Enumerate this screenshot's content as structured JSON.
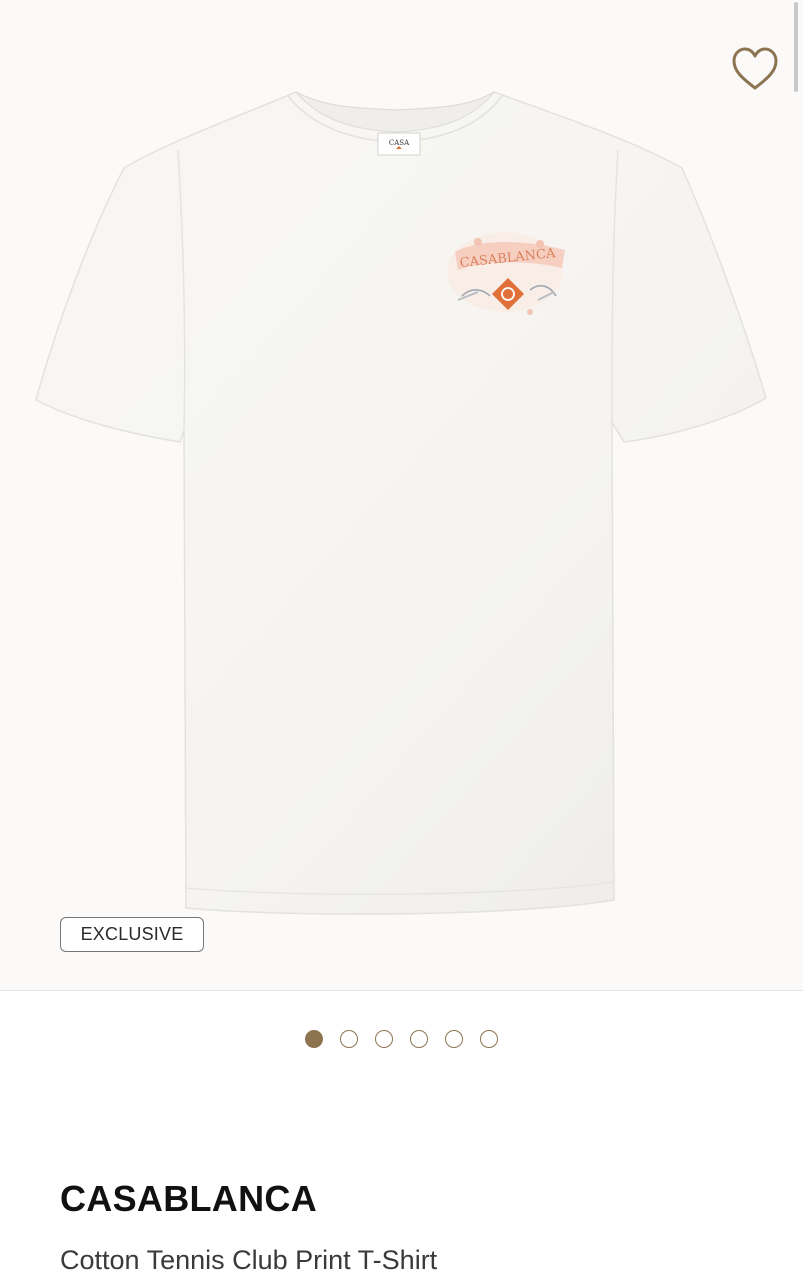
{
  "product": {
    "brand": "CASABLANCA",
    "name": "Cotton Tennis Club Print T-Shirt",
    "badge": "EXCLUSIVE",
    "collar_label": "CASA",
    "print_text": "CASABLANCA"
  },
  "gallery": {
    "image_count": 6,
    "active_index": 0
  },
  "icons": {
    "wishlist": "heart-outline-icon"
  },
  "colors": {
    "accent": "#8d7451",
    "print_orange": "#e0703a",
    "print_pink": "#f1b9a8",
    "shirt": "#f7f6f3"
  }
}
